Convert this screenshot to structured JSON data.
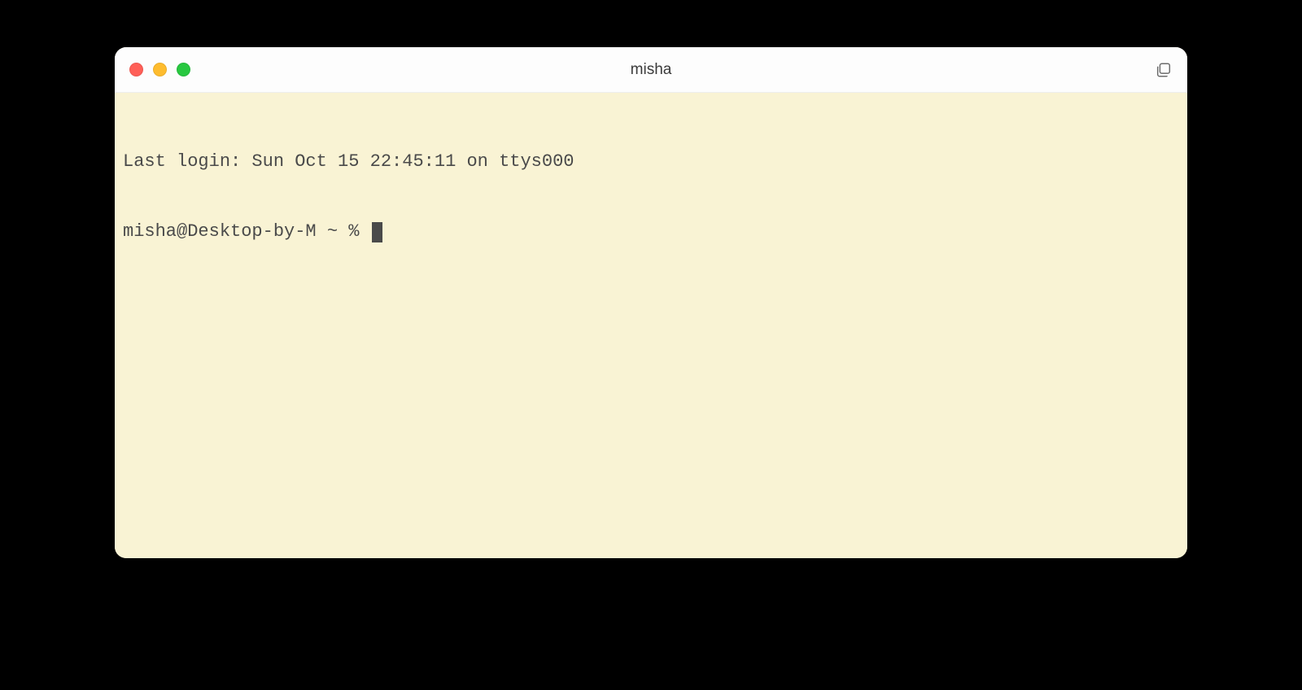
{
  "window": {
    "title": "misha"
  },
  "terminal": {
    "last_login_line": "Last login: Sun Oct 15 22:45:11 on ttys000",
    "prompt": "misha@Desktop-by-M ~ % "
  },
  "colors": {
    "window_bg": "#f9f3d4",
    "titlebar_bg": "#fdfdfd",
    "text": "#4a4a4a",
    "traffic_close": "#ff5f57",
    "traffic_min": "#febc2e",
    "traffic_max": "#28c840"
  }
}
